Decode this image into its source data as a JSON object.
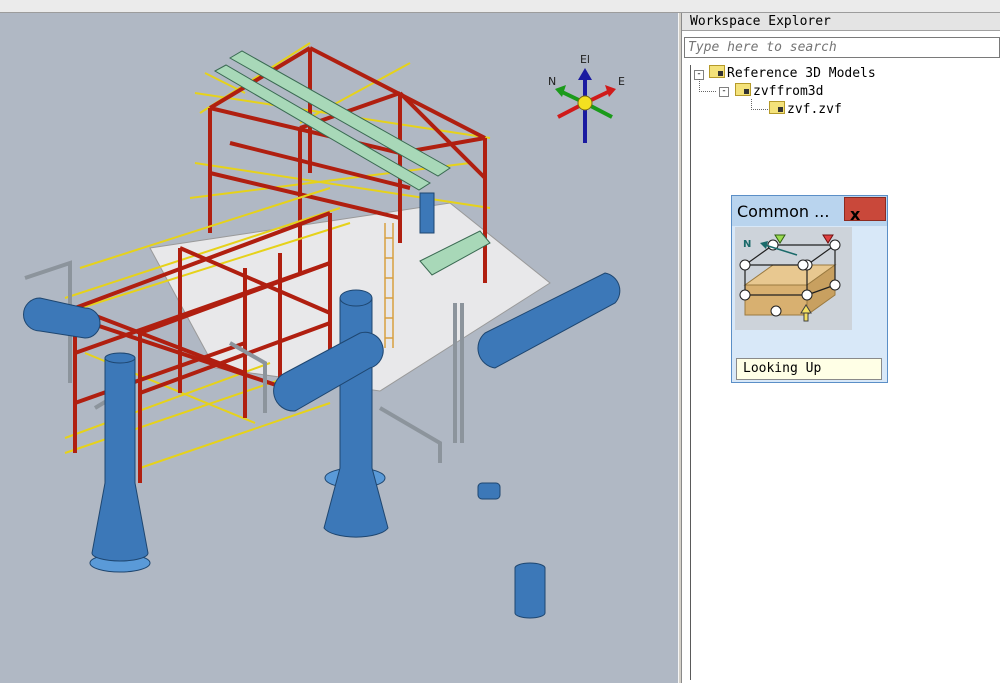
{
  "explorer": {
    "title": "Workspace Explorer",
    "search_placeholder": "Type here to search",
    "tree": [
      {
        "label": "Reference 3D Models",
        "expander": "-"
      },
      {
        "label": "zvffrom3d",
        "expander": "-"
      },
      {
        "label": "zvf.zvf"
      }
    ]
  },
  "compass": {
    "up": "El",
    "north": "N",
    "east": "E"
  },
  "common_views": {
    "title": "Common ...",
    "close_label": "x",
    "north_label": "N",
    "status": "Looking Up"
  },
  "colors": {
    "viewport_bg": "#b0b8c4",
    "steel_red": "#b01f10",
    "steel_yellow": "#e6d21a",
    "equipment_blue": "#3c78b8",
    "pipe_green": "#a8d8b8",
    "close_red": "#c9483a"
  }
}
